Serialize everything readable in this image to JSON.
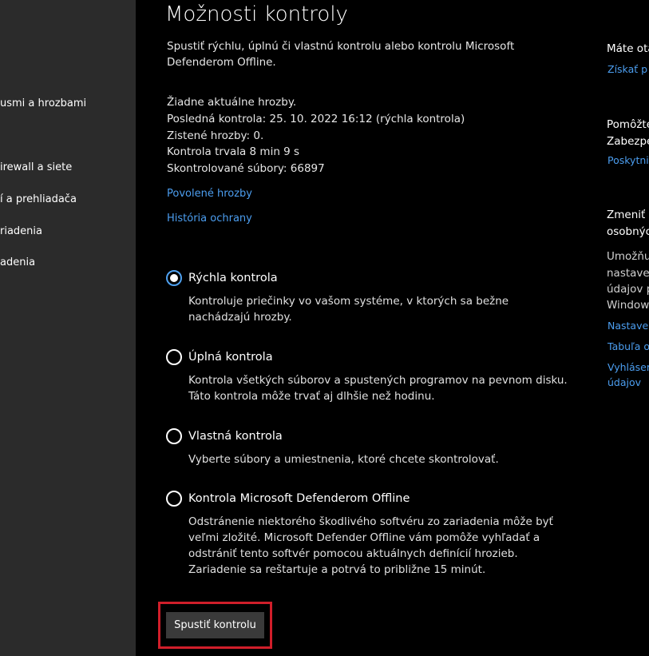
{
  "sidebar": {
    "items": [
      {
        "label": "usmi a hrozbami"
      },
      {
        "label": "irewall a siete"
      },
      {
        "label": "í a prehliadača"
      },
      {
        "label": "riadenia"
      },
      {
        "label": "adenia"
      }
    ]
  },
  "main": {
    "title": "Možnosti kontroly",
    "description": "Spustiť rýchlu, úplnú či vlastnú kontrolu alebo kontrolu Microsoft Defenderom Offline.",
    "status": [
      "Žiadne aktuálne hrozby.",
      "Posledná kontrola: 25. 10. 2022 16:12 (rýchla kontrola)",
      "Zistené hrozby: 0.",
      "Kontrola trvala 8 min 9 s",
      "Skontrolované súbory: 66897"
    ],
    "links": {
      "allowed_threats": "Povolené hrozby",
      "protection_history": "História ochrany"
    },
    "options": [
      {
        "label": "Rýchla kontrola",
        "selected": true,
        "description": "Kontroluje priečinky vo vašom systéme, v ktorých sa bežne nachádzajú hrozby."
      },
      {
        "label": "Úplná kontrola",
        "selected": false,
        "description": "Kontrola všetkých súborov a spustených programov na pevnom disku. Táto kontrola môže trvať aj dlhšie než hodinu."
      },
      {
        "label": "Vlastná kontrola",
        "selected": false,
        "description": "Vyberte súbory a umiestnenia, ktoré chcete skontrolovať."
      },
      {
        "label": "Kontrola Microsoft Defenderom Offline",
        "selected": false,
        "description": "Odstránenie niektorého škodlivého softvéru zo zariadenia môže byť veľmi zložité. Microsoft Defender Offline vám pomôže vyhľadať a odstrániť tento softvér pomocou aktuálnych definícií hrozieb. Zariadenie sa reštartuje a potrvá to približne 15 minút."
      }
    ],
    "scan_button": "Spustiť kontrolu"
  },
  "right_panel": {
    "section1": {
      "heading": "Máte ota",
      "link": "Získať p"
    },
    "section2": {
      "heading_line1": "Pomôžte",
      "heading_line2": "Zabezpe",
      "link": "Poskytni"
    },
    "section3": {
      "heading_line1": "Zmeniť",
      "heading_line2": "osobnýc",
      "body": [
        "Umožňu",
        "nastaver",
        "údajov p",
        "Window"
      ],
      "links": [
        "Nastaver",
        "Tabuľa o",
        "Vyhláser",
        "údajov"
      ]
    }
  },
  "colors": {
    "link": "#4c9ef0",
    "highlight_box": "#d01e2a",
    "sidebar_bg": "#2b2b2b",
    "button_bg": "#3a3a3a"
  }
}
